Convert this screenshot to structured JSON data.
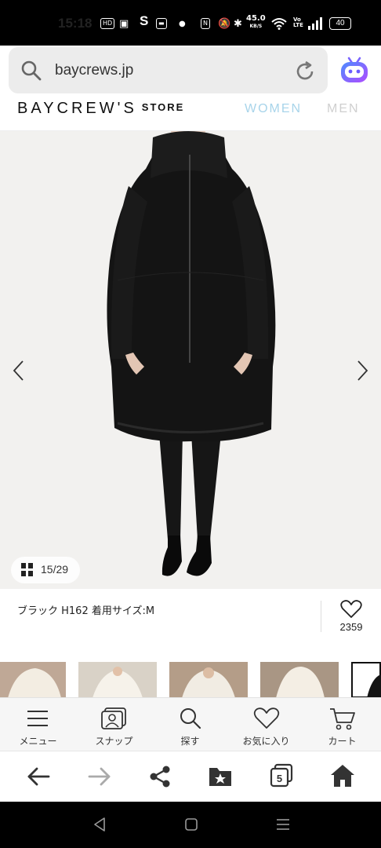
{
  "status_bar": {
    "time": "15:18",
    "speed_value": "45.0",
    "speed_unit": "KB/S",
    "battery": "40"
  },
  "browser": {
    "url": "baycrews.jp",
    "tabs_count": "5"
  },
  "site": {
    "logo": "BAYCREW'S",
    "logo_sub": "STORE",
    "nav": {
      "women": "WOMEN",
      "men": "MEN"
    }
  },
  "product": {
    "image_counter": "15/29",
    "caption": "ブラック H162 着用サイズ:M",
    "favorite_count": "2359",
    "coat_color": "#111111"
  },
  "site_tabs": [
    {
      "label": "メニュー",
      "icon": "menu-icon"
    },
    {
      "label": "スナップ",
      "icon": "snap-icon"
    },
    {
      "label": "探す",
      "icon": "search-icon"
    },
    {
      "label": "お気に入り",
      "icon": "heart-icon"
    },
    {
      "label": "カート",
      "icon": "cart-icon"
    }
  ],
  "colors": {
    "women_accent": "#a8d4ea",
    "image_bg": "#f2f1ef"
  }
}
